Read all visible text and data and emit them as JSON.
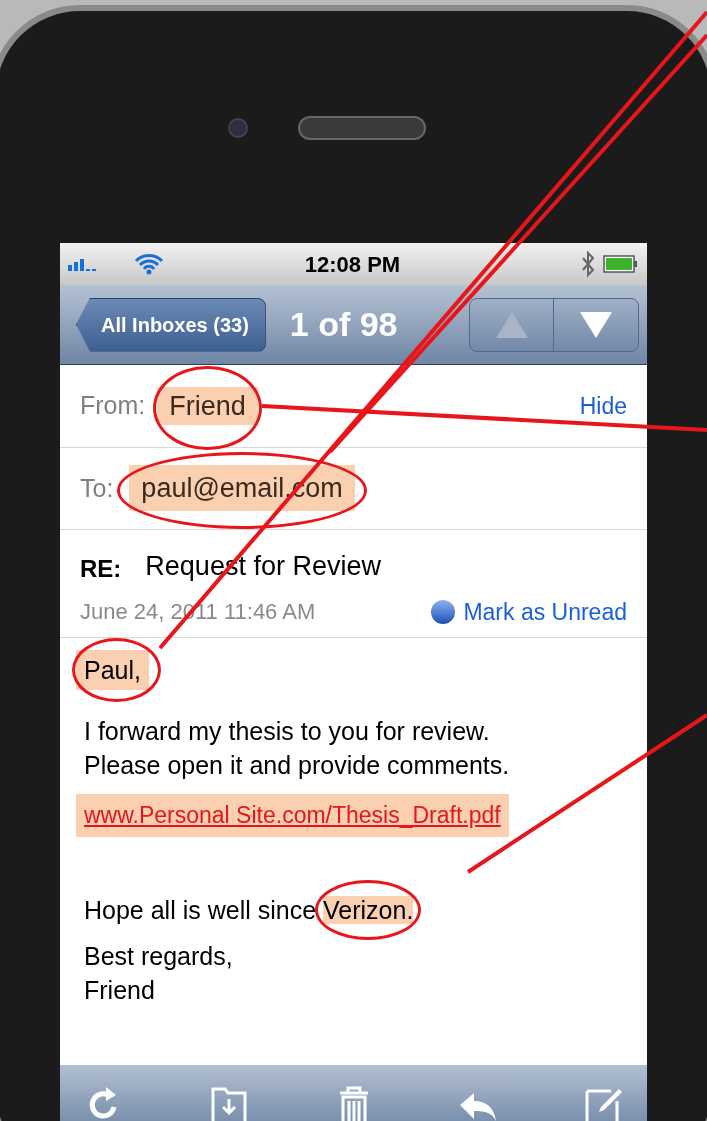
{
  "status_bar": {
    "time": "12:08 PM"
  },
  "nav_bar": {
    "back_button": "All Inboxes (33)",
    "title": "1 of 98",
    "prev_disabled": true,
    "next_disabled": false
  },
  "header": {
    "from_label": "From:",
    "from": {
      "text": "Friend",
      "highlighted": true
    },
    "hide_link": "Hide",
    "to_label": "To:",
    "to": {
      "text": "paul@email.com",
      "highlighted": true
    },
    "subject_label": "RE:",
    "subject": "Request for Review",
    "date": "June 24, 2011 11:46 AM",
    "mark_unread": "Mark as Unread"
  },
  "body": [
    {
      "kind": "text",
      "lines": [
        "Paul,"
      ],
      "highlighted": true
    },
    {
      "kind": "text",
      "lines": [
        "I forward my thesis to you for review.",
        "Please open it and provide comments."
      ],
      "highlighted": false
    },
    {
      "kind": "link",
      "lines": [
        "www.Personal Site.com/Thesis_Draft.pdf"
      ],
      "highlighted": true
    },
    {
      "kind": "split",
      "before": "Hope all is well since ",
      "mark": "Verizon.",
      "highlighted": true
    },
    {
      "kind": "text",
      "lines": [
        "Best regards,",
        "Friend"
      ],
      "highlighted": false
    }
  ]
}
